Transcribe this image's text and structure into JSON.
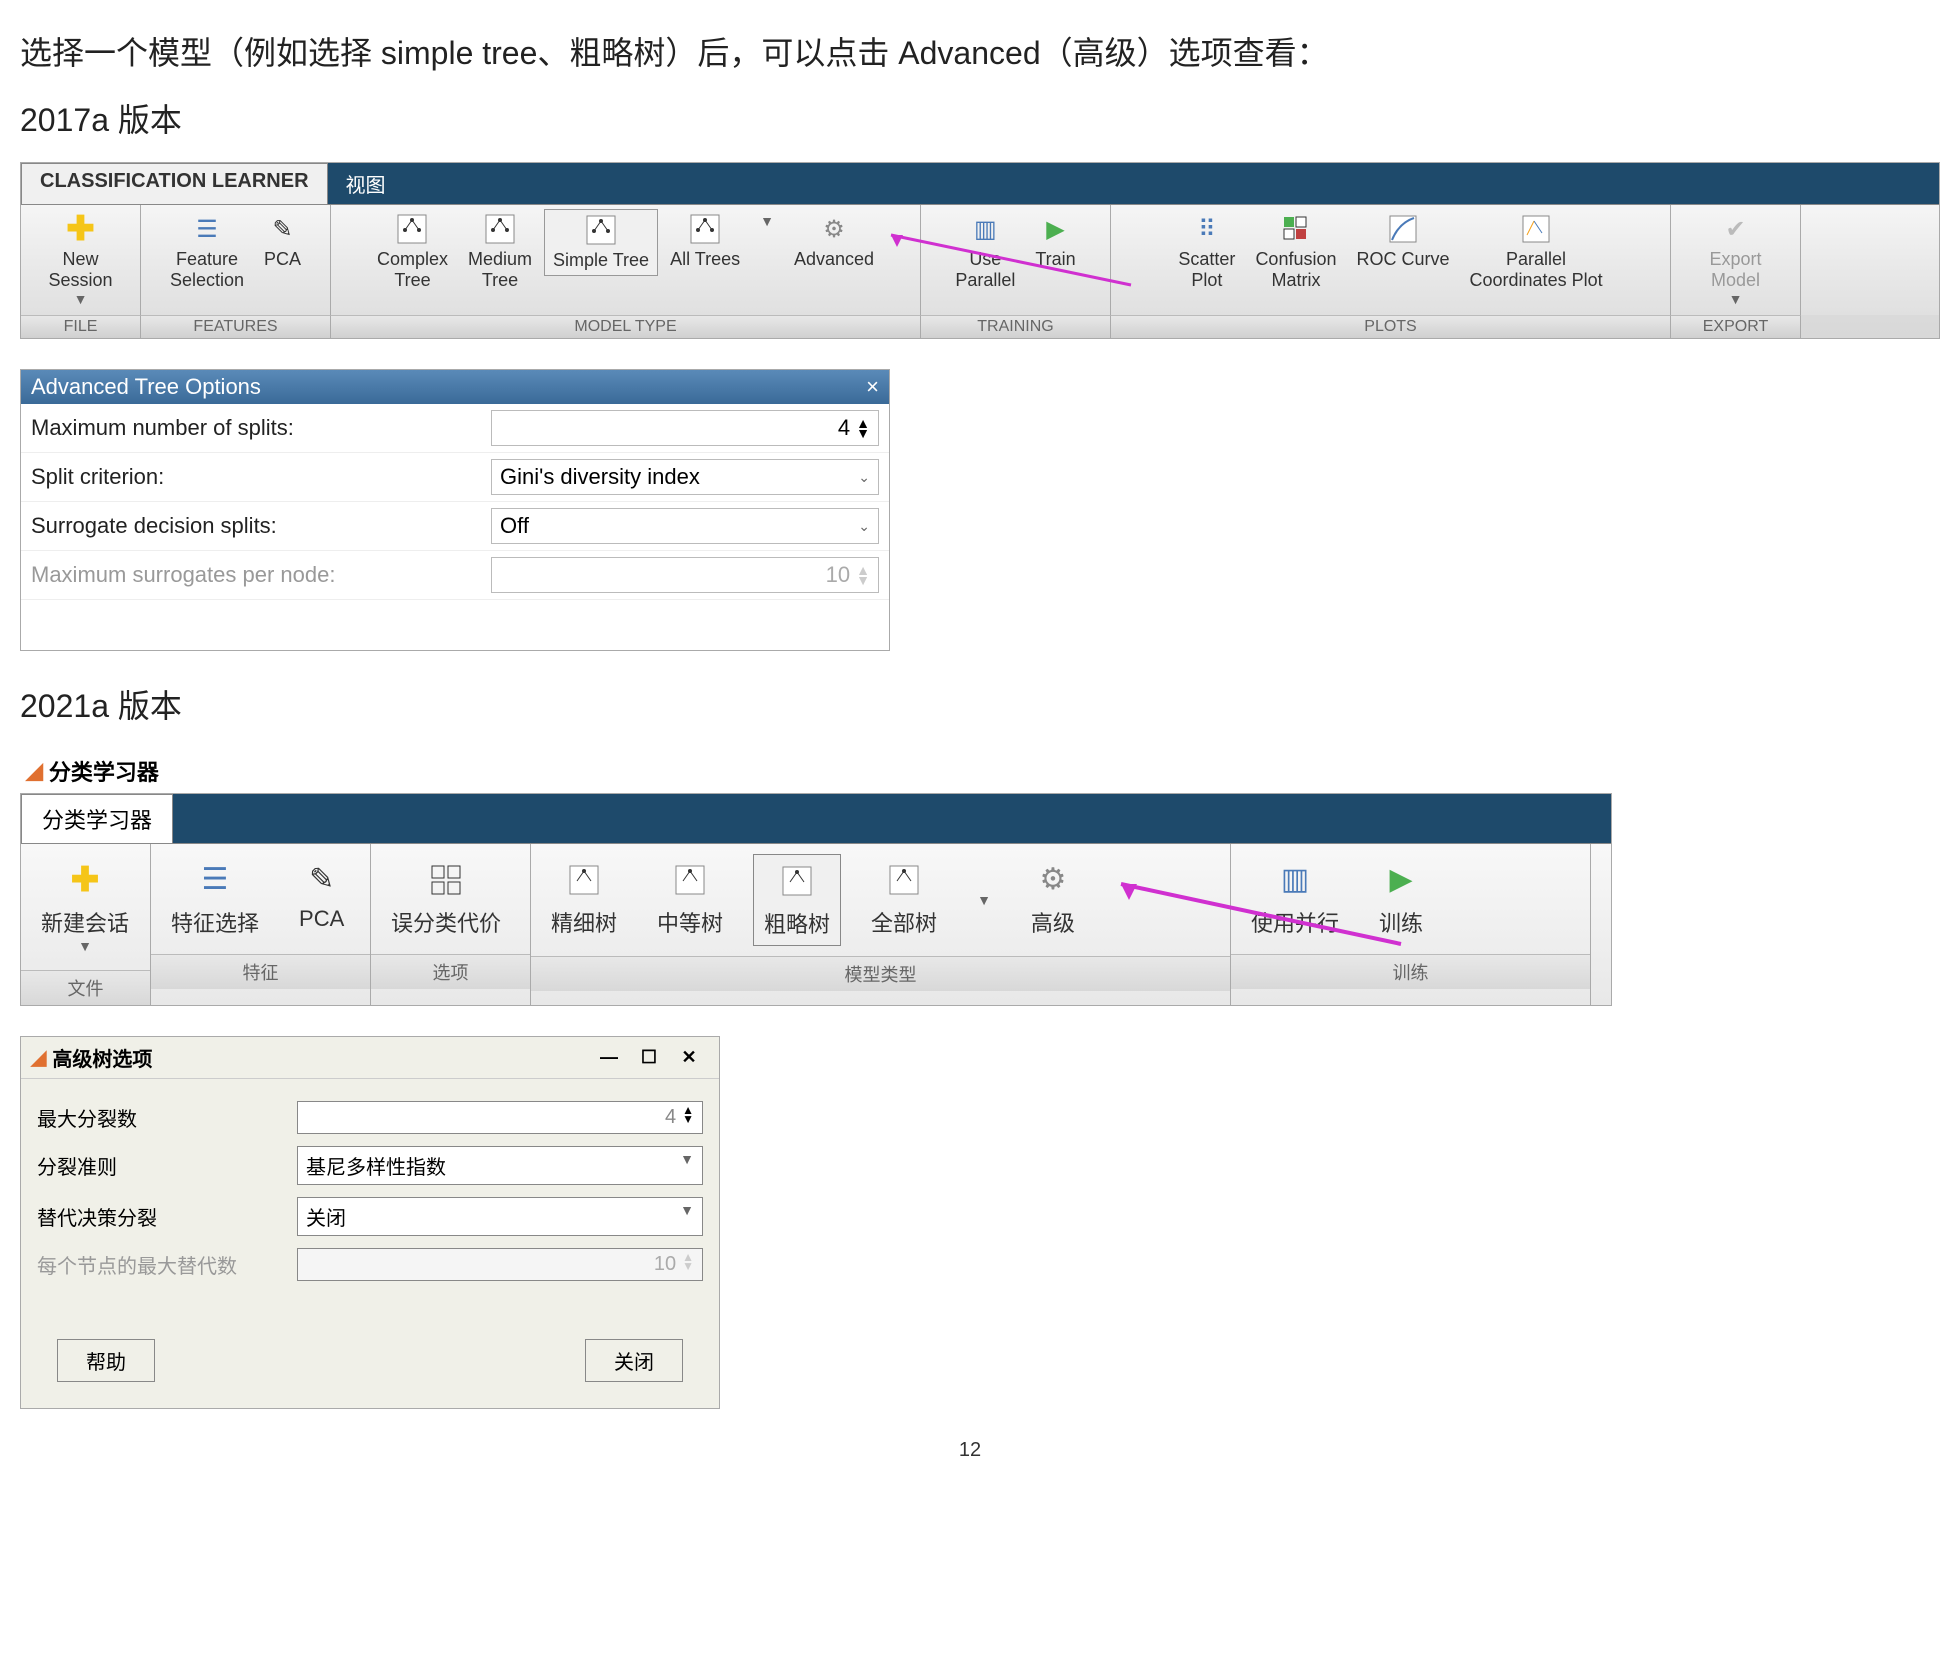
{
  "doc": {
    "intro": "选择一个模型（例如选择 simple tree、粗略树）后，可以点击 Advanced（高级）选项查看：",
    "version2017": "2017a 版本",
    "version2021": "2021a 版本",
    "page_number": "12"
  },
  "toolbar2017": {
    "tab_main": "CLASSIFICATION LEARNER",
    "tab_view": "视图",
    "groups": {
      "file": "FILE",
      "features": "FEATURES",
      "model_type": "MODEL TYPE",
      "training": "TRAINING",
      "plots": "PLOTS",
      "export": "EXPORT"
    },
    "items": {
      "new_session": "New\nSession",
      "feature_selection": "Feature\nSelection",
      "pca": "PCA",
      "complex_tree": "Complex\nTree",
      "medium_tree": "Medium\nTree",
      "simple_tree": "Simple Tree",
      "all_trees": "All Trees",
      "advanced": "Advanced",
      "use_parallel": "Use\nParallel",
      "train": "Train",
      "scatter_plot": "Scatter\nPlot",
      "confusion_matrix": "Confusion\nMatrix",
      "roc_curve": "ROC Curve",
      "parallel_coords": "Parallel\nCoordinates Plot",
      "export_model": "Export\nModel"
    }
  },
  "opt2017": {
    "title": "Advanced Tree Options",
    "close": "×",
    "max_splits_label": "Maximum number of splits:",
    "max_splits_value": "4",
    "split_crit_label": "Split criterion:",
    "split_crit_value": "Gini's diversity index",
    "surrogate_label": "Surrogate decision splits:",
    "surrogate_value": "Off",
    "max_surrogates_label": "Maximum surrogates per node:",
    "max_surrogates_value": "10"
  },
  "app2021": {
    "title": "分类学习器"
  },
  "toolbar2021": {
    "tab_main": "分类学习器",
    "groups": {
      "file": "文件",
      "features": "特征",
      "options": "选项",
      "model_type": "模型类型",
      "training": "训练"
    },
    "items": {
      "new_session": "新建会话",
      "feature_selection": "特征选择",
      "pca": "PCA",
      "misclass": "误分类代价",
      "fine_tree": "精细树",
      "medium_tree": "中等树",
      "coarse_tree": "粗略树",
      "all_trees": "全部树",
      "advanced": "高级",
      "use_parallel": "使用并行",
      "train": "训练"
    }
  },
  "opt2021": {
    "title": "高级树选项",
    "min_btn": "—",
    "max_btn": "☐",
    "close_btn": "✕",
    "max_splits_label": "最大分裂数",
    "max_splits_value": "4",
    "split_crit_label": "分裂准则",
    "split_crit_value": "基尼多样性指数",
    "surrogate_label": "替代决策分裂",
    "surrogate_value": "关闭",
    "max_surrogates_label": "每个节点的最大替代数",
    "max_surrogates_value": "10",
    "help_btn": "帮助",
    "close_action": "关闭"
  }
}
